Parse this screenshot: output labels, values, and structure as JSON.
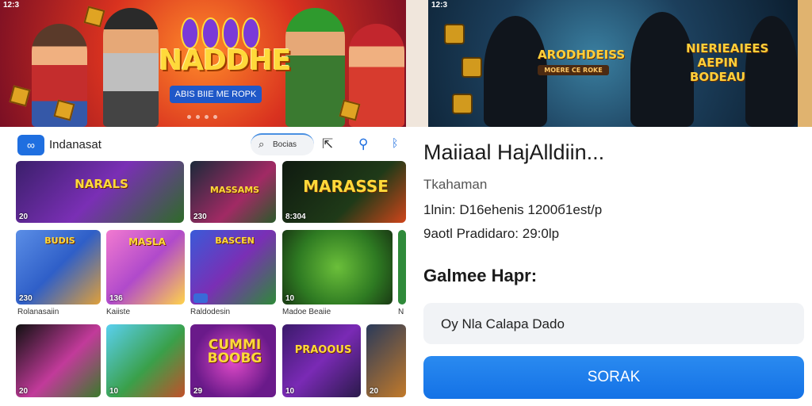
{
  "left": {
    "status_time": "12:3",
    "banner": {
      "logo_text": "NADDHE",
      "logo_subtitle": "ABIS BIIE ME ROPK"
    },
    "appbar": {
      "app_name": "Indanasat",
      "search_label": "Bocias"
    },
    "tiles": [
      {
        "title": "NARALS",
        "badge": "20"
      },
      {
        "title": "MASSAMS",
        "badge": "230"
      },
      {
        "title": "MARASSE",
        "badge": "8:304"
      },
      {
        "title": "BUDIS",
        "badge": "230"
      },
      {
        "title": "MASLA",
        "badge": "136"
      },
      {
        "title": "BASCEN",
        "badge": ""
      },
      {
        "title": "",
        "badge": "10"
      },
      {
        "title": "",
        "badge": ""
      },
      {
        "title": "",
        "badge": "20"
      },
      {
        "title": "",
        "badge": "10"
      },
      {
        "title": "CUMMI BOOBG",
        "badge": "29"
      },
      {
        "title": "PRAOOUS",
        "badge": "10"
      },
      {
        "title": "",
        "badge": "20"
      }
    ],
    "captions": [
      "Rolanasaiin",
      "Kaiiste",
      "Raldodesin",
      "Madoe Beaiie",
      "N"
    ]
  },
  "right": {
    "status_time": "12:3",
    "banner": {
      "title_left": "ARODHDEISS",
      "plate": "MOERE CE ROKE",
      "title_right": "NIERIEAIEES AEPIN BODEAU"
    },
    "detail": {
      "title": "Maiiaal HajAlldiin...",
      "subtitle": "Tkahaman",
      "line1": "1lnin: D16ehenis 1200б1est/p",
      "line2": "9aotl Pradidaro: 29:0lp",
      "section_heading": "Galmee Hapr:",
      "field_value": "Oy Nla Calapa Dado",
      "button_label": "SORAK"
    }
  },
  "colors": {
    "accent": "#1f6fe0",
    "button": "#1a7ceb",
    "field_bg": "#f1f3f6"
  }
}
